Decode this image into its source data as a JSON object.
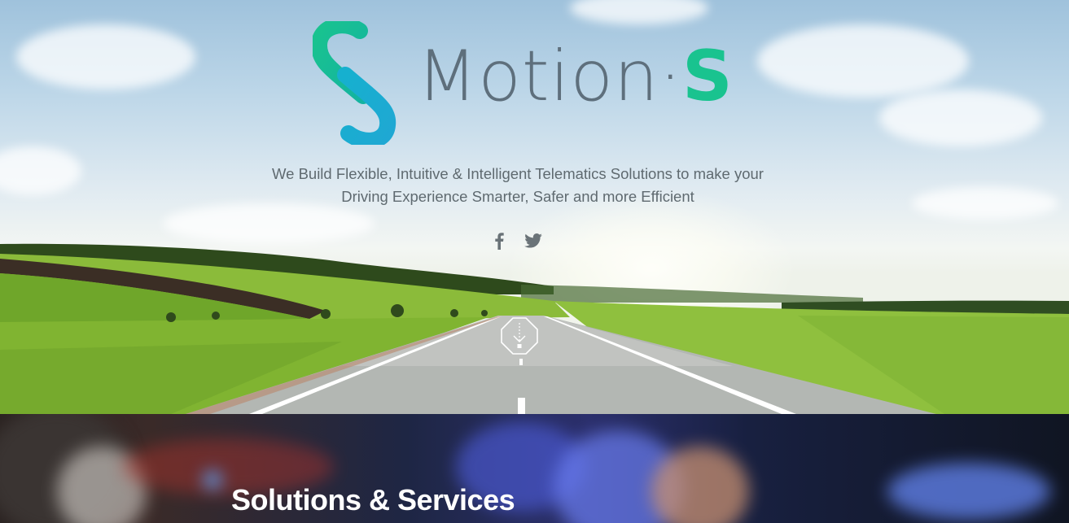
{
  "brand": {
    "name_main": "Motion",
    "name_separator": "·",
    "name_suffix": "S",
    "primary_color": "#19c38f",
    "secondary_color": "#1fa8d3",
    "wordmark_color": "#5e6f7c"
  },
  "hero": {
    "tagline_line1": "We Build Flexible, Intuitive & Intelligent Telematics Solutions to make your",
    "tagline_line2": "Driving Experience Smarter, Safer and more Efficient",
    "social": [
      {
        "icon": "facebook-icon"
      },
      {
        "icon": "twitter-icon"
      }
    ],
    "scroll_icon": "road-sign-scroll-icon"
  },
  "solutions": {
    "title": "Solutions & Services"
  }
}
